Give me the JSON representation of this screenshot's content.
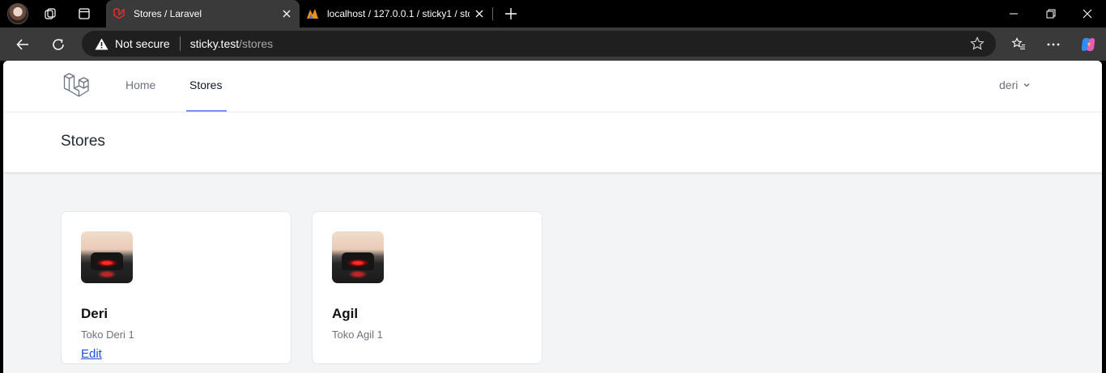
{
  "browser": {
    "tabs": [
      {
        "title": "Stores / Laravel",
        "active": true
      },
      {
        "title": "localhost / 127.0.0.1 / sticky1 / sto",
        "active": false
      }
    ],
    "address": {
      "security_label": "Not secure",
      "host": "sticky.test",
      "path": "/stores"
    }
  },
  "nav": {
    "links": [
      {
        "label": "Home"
      },
      {
        "label": "Stores"
      }
    ],
    "user_name": "deri"
  },
  "header": {
    "title": "Stores"
  },
  "stores": [
    {
      "name": "Deri",
      "description": "Toko Deri 1",
      "action": "Edit"
    },
    {
      "name": "Agil",
      "description": "Toko Agil 1"
    }
  ],
  "colors": {
    "accent_underline": "#818cf8",
    "link": "#1d4ed8",
    "laravel_red": "#ff2d20"
  }
}
